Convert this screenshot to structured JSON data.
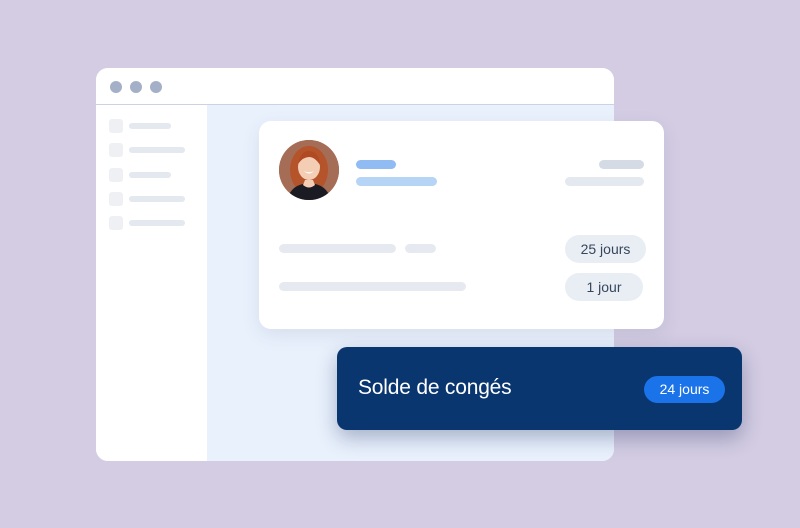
{
  "window": {
    "controls": [
      "close-dot",
      "minimize-dot",
      "maximize-dot"
    ]
  },
  "employee_card": {
    "avatar_icon": "person-photo-icon",
    "rows": [
      {
        "value": "25 jours"
      },
      {
        "value": "1 jour"
      }
    ]
  },
  "balance_card": {
    "title": "Solde de congés",
    "badge": "24 jours"
  },
  "colors": {
    "background": "#d3cce3",
    "accent_navy": "#0a3670",
    "accent_blue": "#1a73e8",
    "content_tint": "#e9f1fd"
  }
}
